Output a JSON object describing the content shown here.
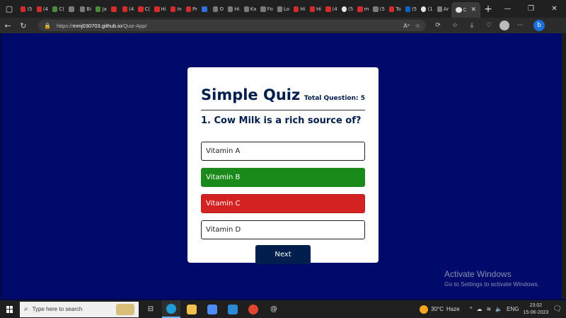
{
  "browser": {
    "tabs": [
      {
        "label": "(5",
        "fav": "red"
      },
      {
        "label": "(4",
        "fav": "red"
      },
      {
        "label": "C(",
        "fav": "green"
      },
      {
        "label": "",
        "fav": "gray"
      },
      {
        "label": "Bi",
        "fav": "gray"
      },
      {
        "label": "Ja",
        "fav": "green"
      },
      {
        "label": "",
        "fav": "red"
      },
      {
        "label": "(4",
        "fav": "red"
      },
      {
        "label": "C(",
        "fav": "red"
      },
      {
        "label": "Hi",
        "fav": "red"
      },
      {
        "label": "In",
        "fav": "red"
      },
      {
        "label": "Pr",
        "fav": "red"
      },
      {
        "label": "",
        "fav": "blue"
      },
      {
        "label": "O",
        "fav": "gray"
      },
      {
        "label": "Hi",
        "fav": "gray"
      },
      {
        "label": "Ka",
        "fav": "gray"
      },
      {
        "label": "Fo",
        "fav": "gray"
      },
      {
        "label": "Lo",
        "fav": "gray"
      },
      {
        "label": "Hi",
        "fav": "red"
      },
      {
        "label": "Hi",
        "fav": "red"
      },
      {
        "label": "(4",
        "fav": "red"
      },
      {
        "label": "(5",
        "fav": "white"
      },
      {
        "label": "m",
        "fav": "red"
      },
      {
        "label": "(5",
        "fav": "gray"
      },
      {
        "label": "To",
        "fav": "red"
      },
      {
        "label": "(5",
        "fav": "lin"
      },
      {
        "label": "(1",
        "fav": "white"
      },
      {
        "label": "Ar",
        "fav": "gray"
      }
    ],
    "active_tab_label": "C",
    "url_prefix": "https://",
    "url_host": "mmj030703.github.io",
    "url_path": "/Quiz-App/"
  },
  "quiz": {
    "title": "Simple Quiz",
    "total_label": "Total Question: 5",
    "question": "1. Cow Milk is a rich source of?",
    "answers": [
      {
        "label": "Vitamin A",
        "state": "neutral"
      },
      {
        "label": "Vitamin B",
        "state": "correct"
      },
      {
        "label": "Vitamin C",
        "state": "incorrect"
      },
      {
        "label": "Vitamin D",
        "state": "neutral"
      }
    ],
    "next_label": "Next"
  },
  "watermark": {
    "line1": "Activate Windows",
    "line2": "Go to Settings to activate Windows."
  },
  "taskbar": {
    "search_placeholder": "Type here to search",
    "weather_temp": "30°C",
    "weather_desc": "Haze",
    "language": "ENG",
    "time": "23:02",
    "date": "15-06-2023"
  },
  "colors": {
    "page_bg": "#000a6b",
    "card_bg": "#ffffff",
    "title": "#001e4d",
    "correct": "#1a8a1a",
    "incorrect": "#d42222",
    "next_bg": "#001e4d"
  }
}
